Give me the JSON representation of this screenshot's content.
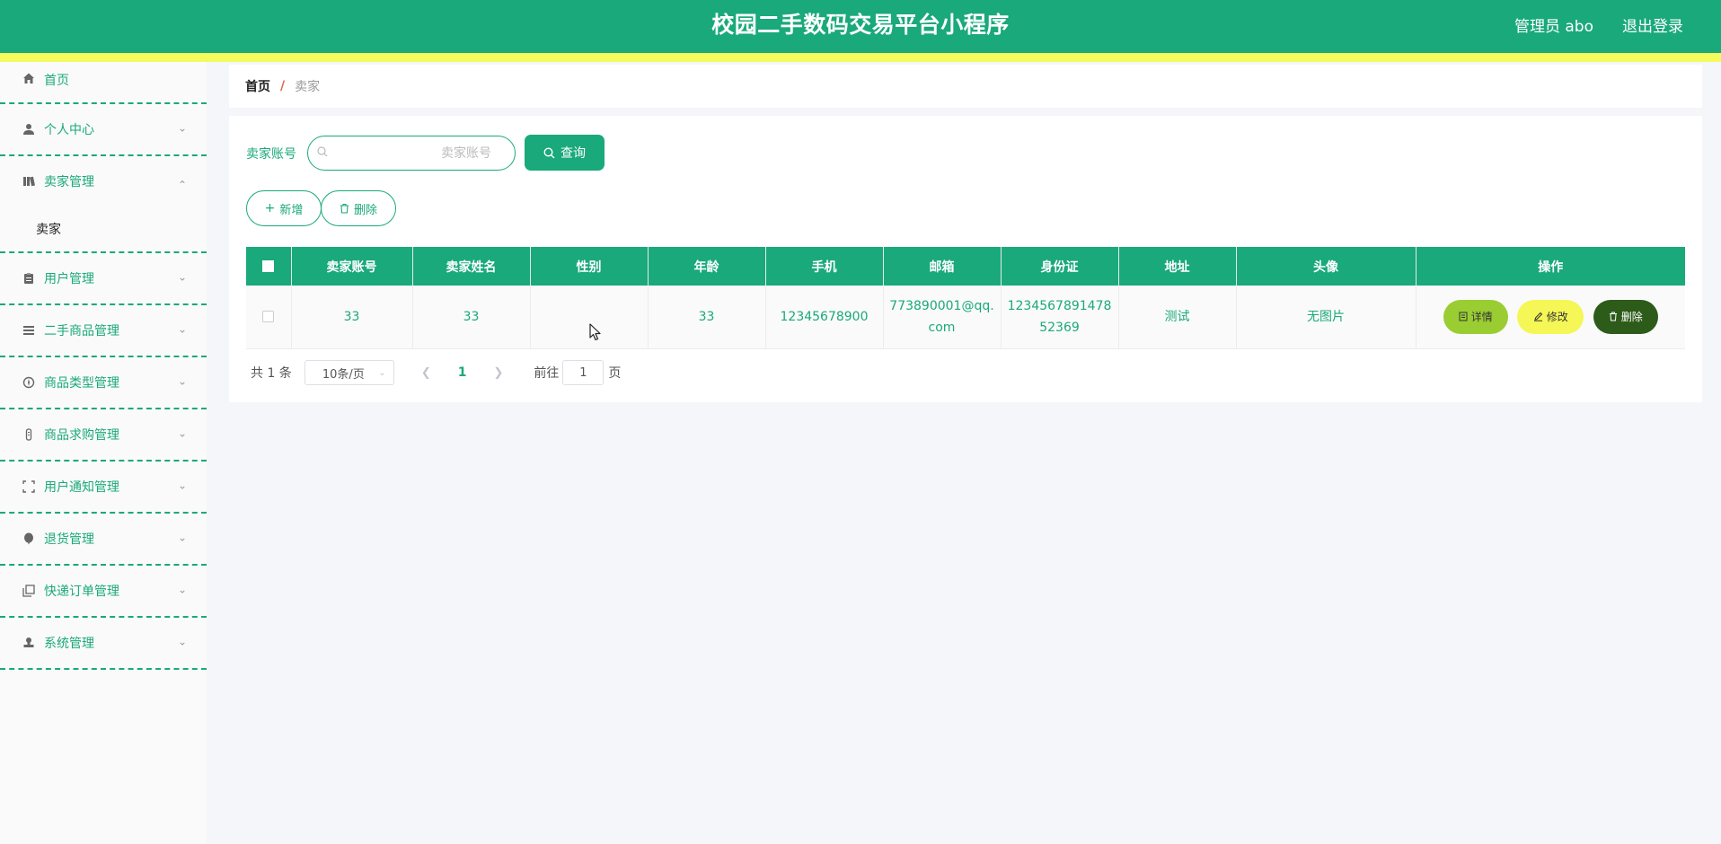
{
  "header": {
    "title": "校园二手数码交易平台小程序",
    "admin": "管理员 abo",
    "logout": "退出登录"
  },
  "sidebar": {
    "items": [
      {
        "label": "首页",
        "icon": "home-icon"
      },
      {
        "label": "个人中心",
        "icon": "user-icon"
      },
      {
        "label": "卖家管理",
        "icon": "book-icon",
        "expanded": true,
        "children": [
          {
            "label": "卖家"
          }
        ]
      },
      {
        "label": "用户管理",
        "icon": "clipboard-icon"
      },
      {
        "label": "二手商品管理",
        "icon": "list-icon"
      },
      {
        "label": "商品类型管理",
        "icon": "compass-icon"
      },
      {
        "label": "商品求购管理",
        "icon": "mic-icon"
      },
      {
        "label": "用户通知管理",
        "icon": "fullscreen-icon"
      },
      {
        "label": "退货管理",
        "icon": "balloon-icon"
      },
      {
        "label": "快递订单管理",
        "icon": "copy-icon"
      },
      {
        "label": "系统管理",
        "icon": "stamp-icon"
      }
    ]
  },
  "breadcrumb": {
    "home": "首页",
    "sep": "/",
    "current": "卖家"
  },
  "search": {
    "label": "卖家账号",
    "placeholder": "卖家账号",
    "button": "查询"
  },
  "actions": {
    "add": "新增",
    "delete": "删除"
  },
  "table": {
    "columns": [
      "卖家账号",
      "卖家姓名",
      "性别",
      "年龄",
      "手机",
      "邮箱",
      "身份证",
      "地址",
      "头像",
      "操作"
    ],
    "rows": [
      {
        "account": "33",
        "name": "33",
        "gender": "",
        "age": "33",
        "phone": "12345678900",
        "email_line1": "773890001@qq.",
        "email_line2": "com",
        "idcard_line1": "1234567891478",
        "idcard_line2": "52369",
        "address": "测试",
        "avatar": "无图片",
        "ops": {
          "detail": "详情",
          "edit": "修改",
          "delete": "删除"
        }
      }
    ]
  },
  "pagination": {
    "total": "共 1 条",
    "page_size": "10条/页",
    "current": "1",
    "goto_prefix": "前往",
    "goto_value": "1",
    "goto_suffix": "页"
  },
  "colors": {
    "primary": "#1aa97a",
    "stripe": "#f4fb5c",
    "detail": "#9acd32",
    "edit": "#f4f755",
    "delete": "#2d5b1a"
  }
}
